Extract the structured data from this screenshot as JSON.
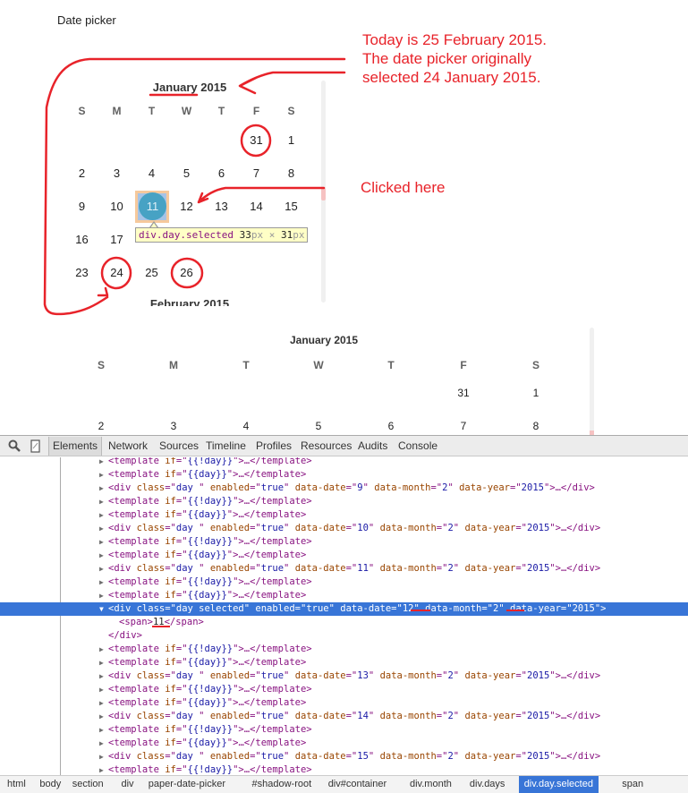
{
  "page": {
    "title": "Date picker"
  },
  "picker_small": {
    "month_title": "January 2015",
    "next_month_title": "February 2015",
    "weekdays": [
      "S",
      "M",
      "T",
      "W",
      "T",
      "F",
      "S"
    ],
    "weeks": [
      [
        "",
        "",
        "",
        "",
        "",
        "31",
        "1"
      ],
      [
        "2",
        "3",
        "4",
        "5",
        "6",
        "7",
        "8"
      ],
      [
        "9",
        "10",
        "11",
        "12",
        "13",
        "14",
        "15"
      ],
      [
        "16",
        "17",
        "",
        "",
        "",
        "",
        ""
      ],
      [
        "23",
        "24",
        "25",
        "26",
        "",
        "",
        ""
      ]
    ],
    "selected_day": "11",
    "tooltip": {
      "selector": "div.day.selected",
      "width": "33",
      "height": "31",
      "unit": "px",
      "times": "×"
    }
  },
  "annotations": {
    "note_top": [
      "Today is 25 February 2015.",
      "The date picker originally",
      "selected 24 January 2015."
    ],
    "note_click": "Clicked here",
    "color": "#e8232a"
  },
  "picker_large": {
    "month_title": "January 2015",
    "weekdays": [
      "S",
      "M",
      "T",
      "W",
      "T",
      "F",
      "S"
    ],
    "weeks": [
      [
        "",
        "",
        "",
        "",
        "",
        "31",
        "1"
      ],
      [
        "2",
        "3",
        "4",
        "5",
        "6",
        "7",
        "8"
      ]
    ]
  },
  "devtools": {
    "tabs": [
      "Elements",
      "Network",
      "Sources",
      "Timeline",
      "Profiles",
      "Resources",
      "Audits",
      "Console"
    ],
    "active_tab": "Elements",
    "icons": {
      "search": "search-icon",
      "device": "device-mode-icon"
    },
    "lines": [
      {
        "kind": "template",
        "cond": "{{!day}}",
        "partial": true
      },
      {
        "kind": "template",
        "cond": "{{day}}"
      },
      {
        "kind": "div",
        "cls": "day ",
        "date": "9",
        "month": "2",
        "year": "2015"
      },
      {
        "kind": "template",
        "cond": "{{!day}}"
      },
      {
        "kind": "template",
        "cond": "{{day}}"
      },
      {
        "kind": "div",
        "cls": "day ",
        "date": "10",
        "month": "2",
        "year": "2015"
      },
      {
        "kind": "template",
        "cond": "{{!day}}"
      },
      {
        "kind": "template",
        "cond": "{{day}}"
      },
      {
        "kind": "div",
        "cls": "day ",
        "date": "11",
        "month": "2",
        "year": "2015"
      },
      {
        "kind": "template",
        "cond": "{{!day}}"
      },
      {
        "kind": "template",
        "cond": "{{day}}"
      },
      {
        "kind": "div-open",
        "cls": "day selected",
        "date": "12",
        "month": "2",
        "year": "2015",
        "selected": true
      },
      {
        "kind": "span",
        "text": "11"
      },
      {
        "kind": "close-div"
      },
      {
        "kind": "template",
        "cond": "{{!day}}"
      },
      {
        "kind": "template",
        "cond": "{{day}}"
      },
      {
        "kind": "div",
        "cls": "day ",
        "date": "13",
        "month": "2",
        "year": "2015"
      },
      {
        "kind": "template",
        "cond": "{{!day}}"
      },
      {
        "kind": "template",
        "cond": "{{day}}"
      },
      {
        "kind": "div",
        "cls": "day ",
        "date": "14",
        "month": "2",
        "year": "2015"
      },
      {
        "kind": "template",
        "cond": "{{!day}}"
      },
      {
        "kind": "template",
        "cond": "{{day}}"
      },
      {
        "kind": "div",
        "cls": "day ",
        "date": "15",
        "month": "2",
        "year": "2015"
      },
      {
        "kind": "template",
        "cond": "{{!day}}"
      },
      {
        "kind": "template",
        "cond": "{{day}}",
        "partial": true
      }
    ],
    "breadcrumbs": [
      "html",
      "body",
      "section",
      "div",
      "paper-date-picker",
      "#shadow-root",
      "div#container",
      "div.month",
      "div.days",
      "div.day.selected",
      "span"
    ],
    "active_breadcrumb": "div.day.selected",
    "selection_color": "#3875d7"
  }
}
